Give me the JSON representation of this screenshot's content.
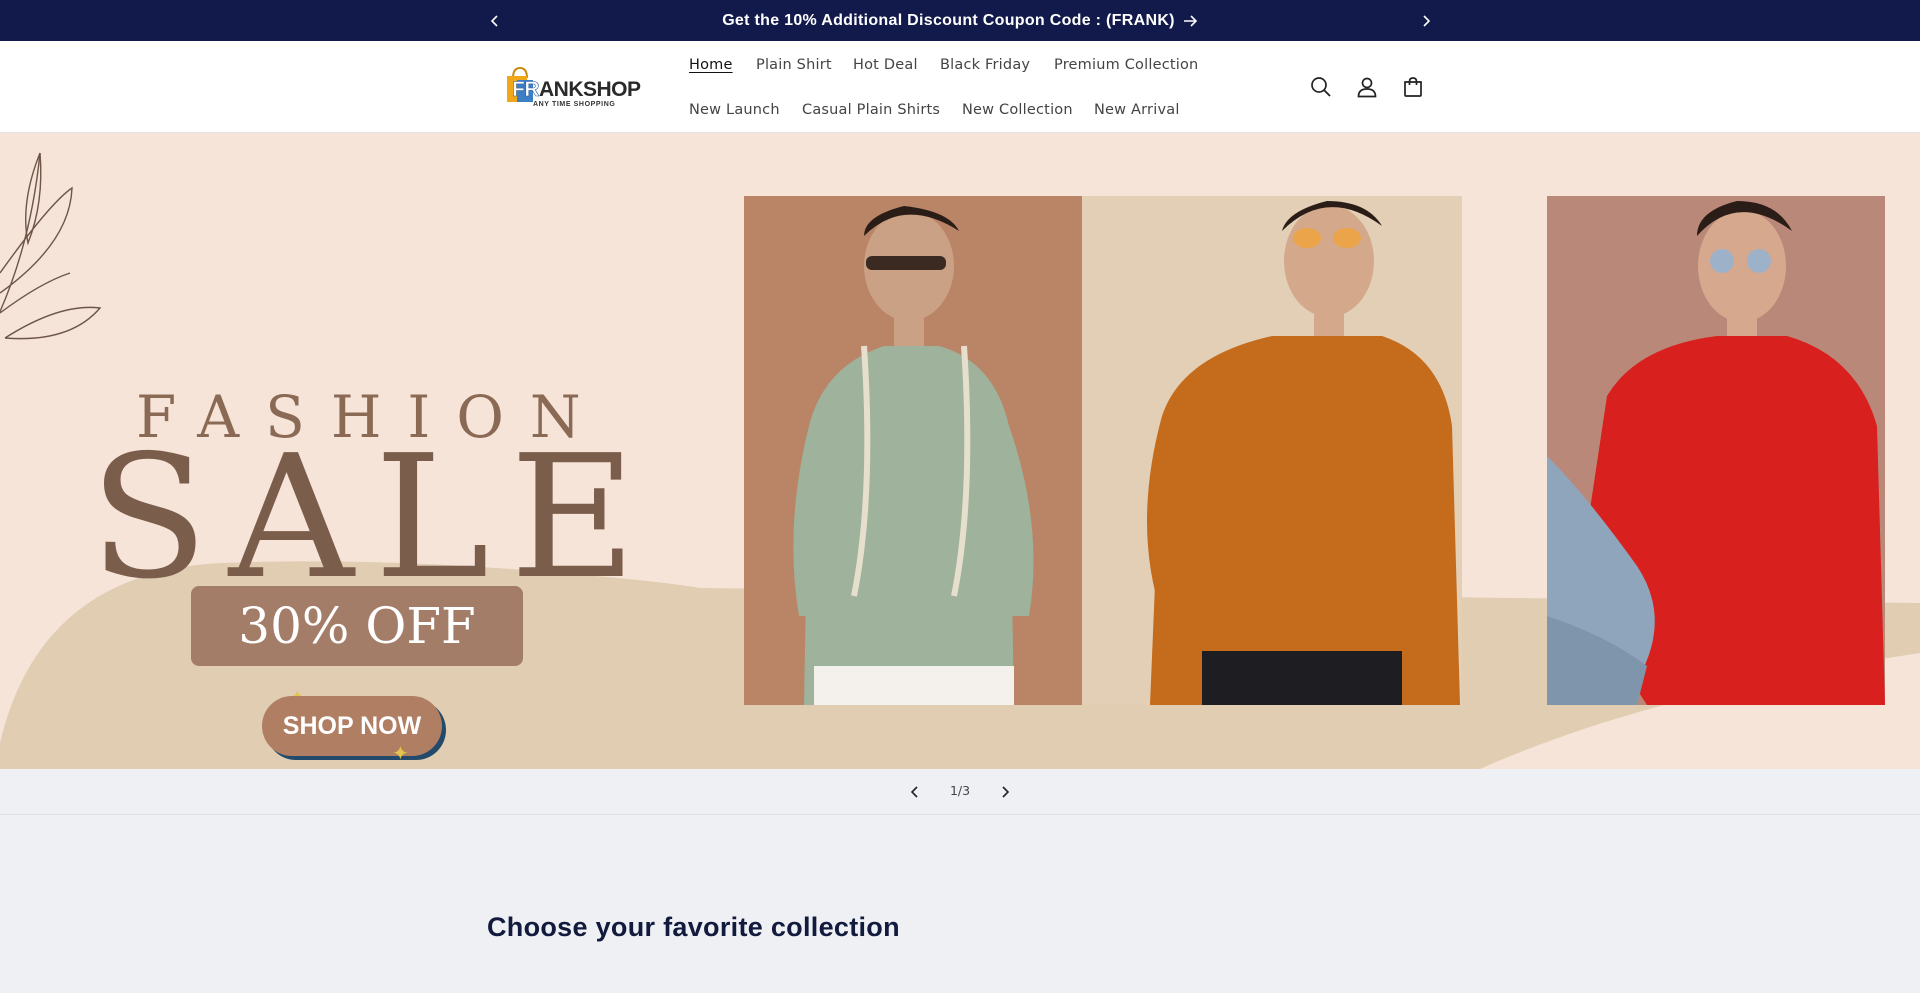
{
  "announcement": {
    "text": "Get the 10% Additional Discount Coupon Code : (FRANK)",
    "prev_icon": "chevron-left-icon",
    "next_icon": "chevron-right-icon",
    "arrow_icon": "arrow-right-icon"
  },
  "header": {
    "logo": {
      "brand": "FRANKSHOP",
      "brand_first": "FR",
      "brand_rest": "ANKSHOP",
      "tagline": "ANY TIME SHOPPING"
    },
    "nav": [
      {
        "label": "Home",
        "active": true
      },
      {
        "label": "Plain Shirt"
      },
      {
        "label": "Hot Deal"
      },
      {
        "label": "Black Friday"
      },
      {
        "label": "Premium Collection"
      },
      {
        "label": "New Launch"
      },
      {
        "label": "Casual Plain Shirts"
      },
      {
        "label": "New Collection"
      },
      {
        "label": "New Arrival"
      }
    ],
    "icons": [
      "search-icon",
      "account-icon",
      "cart-icon"
    ]
  },
  "hero": {
    "headline_top": "FASHION",
    "headline_main": "SALE",
    "discount": "30% OFF",
    "cta": "SHOP NOW",
    "shirt_colors": [
      "#9fb29c",
      "#c46b1c",
      "#d8201f"
    ]
  },
  "slider": {
    "counter": "1/3"
  },
  "collections": {
    "title": "Choose your favorite collection"
  },
  "colors": {
    "announcement_bg": "#111a4a",
    "hero_bg": "#f6e4d8",
    "accent_brown": "#a47d68"
  }
}
